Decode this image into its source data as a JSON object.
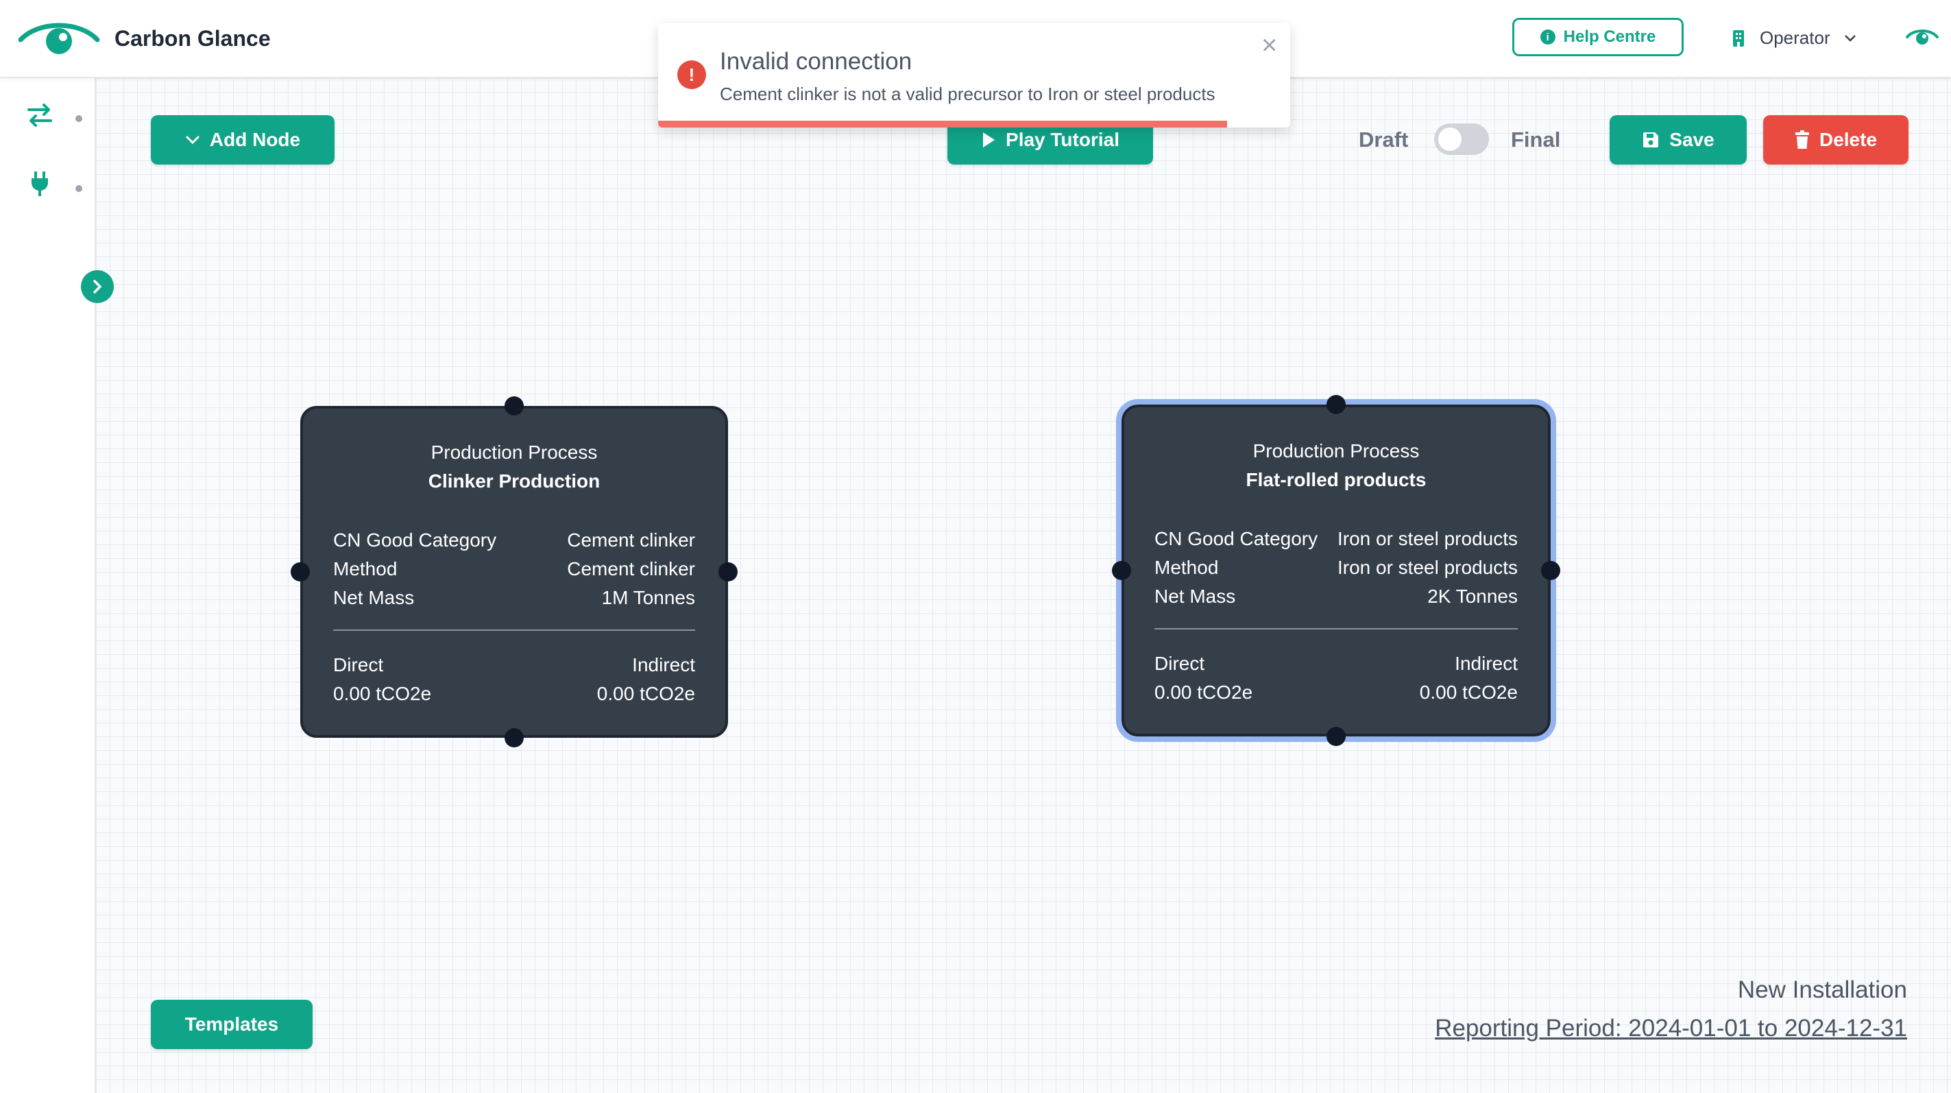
{
  "header": {
    "app_title": "Carbon Glance",
    "logo_icon": "eye-logo-icon",
    "help_label": "Help Centre",
    "operator_label": "Operator",
    "accent_color": "#10a589"
  },
  "toolbar": {
    "add_node_label": "Add Node",
    "play_tutorial_label": "Play Tutorial",
    "draft_label": "Draft",
    "final_label": "Final",
    "save_label": "Save",
    "delete_label": "Delete",
    "templates_label": "Templates",
    "delete_color": "#ea4b40"
  },
  "toast": {
    "title": "Invalid connection",
    "message": "Cement clinker is not a valid precursor to Iron or steel products",
    "close_glyph": "×",
    "icon_glyph": "!",
    "progress": 0.9
  },
  "nodes": [
    {
      "type_label": "Production Process",
      "name": "Clinker Production",
      "rows": [
        {
          "label": "CN Good Category",
          "value": "Cement clinker"
        },
        {
          "label": "Method",
          "value": "Cement clinker"
        },
        {
          "label": "Net Mass",
          "value": "1M Tonnes"
        }
      ],
      "direct_label": "Direct",
      "indirect_label": "Indirect",
      "direct_value": "0.00 tCO2e",
      "indirect_value": "0.00 tCO2e",
      "selected": false
    },
    {
      "type_label": "Production Process",
      "name": "Flat-rolled products",
      "rows": [
        {
          "label": "CN Good Category",
          "value": "Iron or steel products"
        },
        {
          "label": "Method",
          "value": "Iron or steel products"
        },
        {
          "label": "Net Mass",
          "value": "2K Tonnes"
        }
      ],
      "direct_label": "Direct",
      "indirect_label": "Indirect",
      "direct_value": "0.00 tCO2e",
      "indirect_value": "0.00 tCO2e",
      "selected": true
    }
  ],
  "footer": {
    "installation": "New Installation",
    "reporting_period": "Reporting Period: 2024-01-01 to 2024-12-31"
  }
}
